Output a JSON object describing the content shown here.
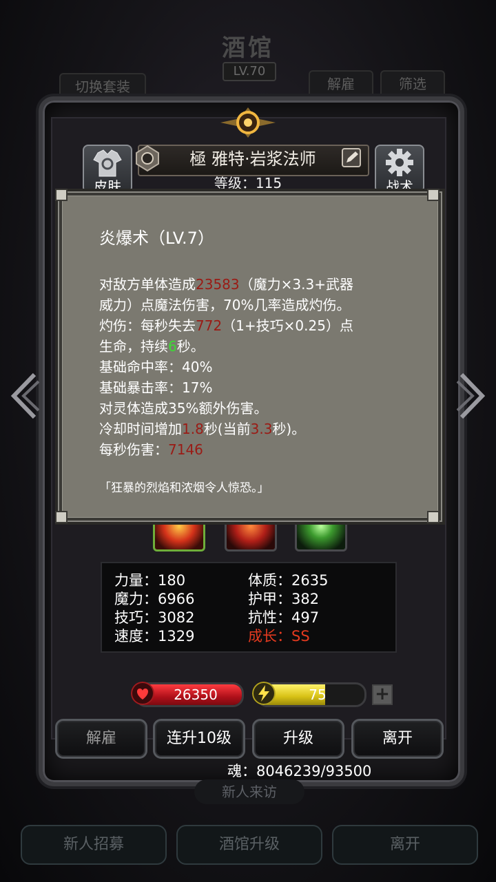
{
  "background": {
    "title": "酒馆",
    "level": "LV.70",
    "switch_outfit": "切换套装",
    "dismiss": "解雇",
    "filter": "筛选",
    "visitor": "新人来访",
    "bottom": [
      "新人招募",
      "酒馆升级",
      "离开"
    ]
  },
  "hero": {
    "name": "極 雅特·岩浆法师",
    "level_label": "等级：115",
    "skin_label": "皮肤",
    "tactics_label": "战术"
  },
  "tooltip": {
    "title": "炎爆术（LV.7）",
    "lines": [
      {
        "segments": [
          {
            "t": "对敌方单体造成"
          },
          {
            "t": "23583",
            "c": "red"
          },
          {
            "t": "（魔力×3.3+武器"
          }
        ]
      },
      {
        "segments": [
          {
            "t": "威力）点魔法伤害，70%几率造成灼伤。"
          }
        ]
      },
      {
        "segments": [
          {
            "t": "灼伤：每秒失去"
          },
          {
            "t": "772",
            "c": "red"
          },
          {
            "t": "（1+技巧×0.25）点"
          }
        ]
      },
      {
        "segments": [
          {
            "t": "生命，持续"
          },
          {
            "t": "6",
            "c": "green"
          },
          {
            "t": "秒。"
          }
        ]
      },
      {
        "segments": [
          {
            "t": "基础命中率：40%"
          }
        ]
      },
      {
        "segments": [
          {
            "t": "基础暴击率：17%"
          }
        ]
      },
      {
        "segments": [
          {
            "t": "对灵体造成35%额外伤害。"
          }
        ]
      },
      {
        "segments": [
          {
            "t": "冷却时间增加"
          },
          {
            "t": "1.8",
            "c": "red"
          },
          {
            "t": "秒(当前"
          },
          {
            "t": "3.3",
            "c": "red"
          },
          {
            "t": "秒)。"
          }
        ]
      },
      {
        "segments": [
          {
            "t": "每秒伤害："
          },
          {
            "t": "7146",
            "c": "red"
          }
        ]
      }
    ],
    "quote": "「狂暴的烈焰和浓烟令人惊恐。」"
  },
  "stats": {
    "strength": "力量：180",
    "constitution": "体质：2635",
    "magic": "魔力：6966",
    "armor": "护甲：382",
    "skill": "技巧：3082",
    "resistance": "抗性：497",
    "speed": "速度：1329",
    "growth": "成长：SS"
  },
  "bars": {
    "hp": "26350",
    "energy": "75",
    "energy_fill": 0.63
  },
  "actions": {
    "dismiss": "解雇",
    "level_up_10": "连升10级",
    "level_up": "升级",
    "leave": "离开"
  },
  "soul": "魂：8046239/93500",
  "colors": {
    "tooltip_bg": "#7b7970",
    "highlight_red": "#9a1b15",
    "highlight_green": "#3bdc33",
    "growth": "#e43a1f",
    "hp_bar": "#c8171d",
    "energy_bar": "#d8c21a"
  },
  "icons": [
    "shirt-icon",
    "gear-icon",
    "edit-icon",
    "gem-icon",
    "heart-icon",
    "lightning-icon",
    "plus-icon",
    "chevron-left-icon",
    "chevron-right-icon"
  ]
}
